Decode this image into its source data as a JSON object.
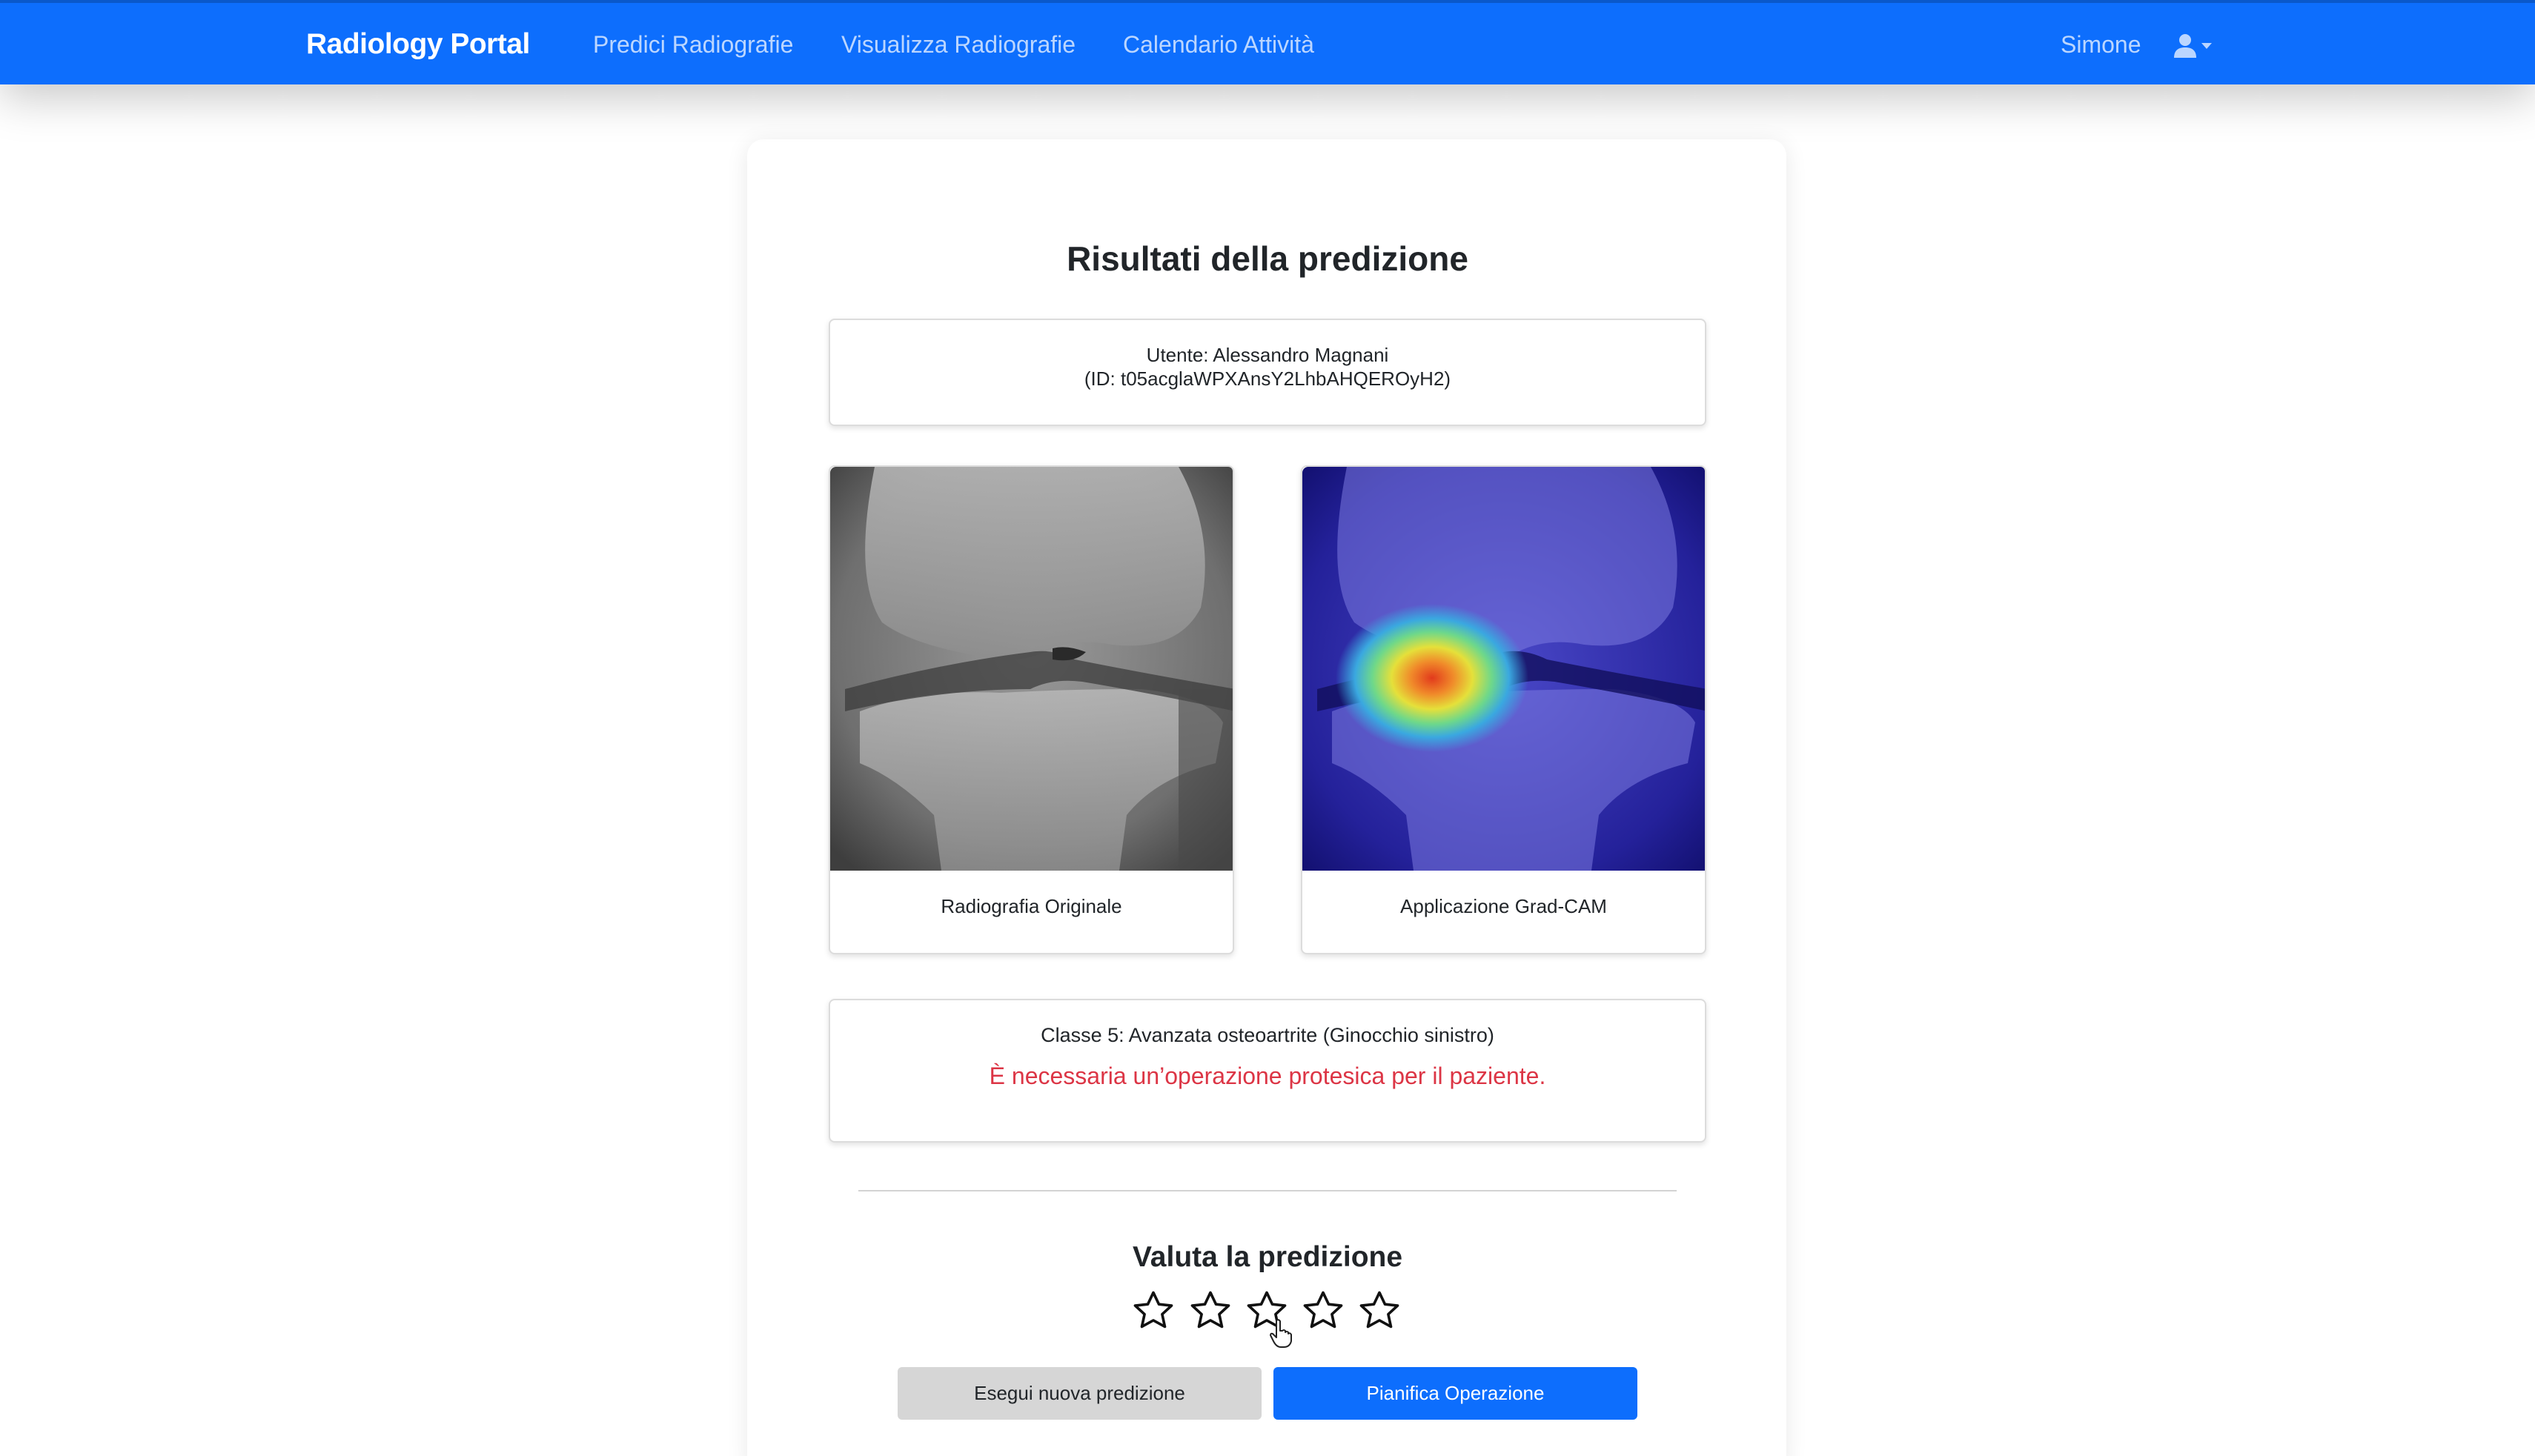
{
  "navbar": {
    "brand": "Radiology Portal",
    "links": [
      "Predici Radiografie",
      "Visualizza Radiografie",
      "Calendario Attività"
    ],
    "user_name": "Simone",
    "user_icon": "user-icon",
    "dropdown_icon": "caret-down-icon",
    "bg_color": "#0d6efd"
  },
  "page": {
    "title": "Risultati della predizione"
  },
  "user_info": {
    "line1": "Utente: Alessandro Magnani",
    "line2": "(ID: t05acglaWPXAnsY2LhbAHQEROyH2)"
  },
  "images": [
    {
      "caption": "Radiografia Originale",
      "kind": "x-ray-knee"
    },
    {
      "caption": "Applicazione Grad-CAM",
      "kind": "grad-cam-heatmap"
    }
  ],
  "result": {
    "class_label": "Classe 5: Avanzata osteoartrite (Ginocchio sinistro)",
    "warning": "È necessaria un’operazione protesica per il paziente.",
    "warning_color": "#dc3545"
  },
  "rating": {
    "title": "Valuta la predizione",
    "max_stars": 5,
    "selected": 0,
    "star_icon": "star-outline-icon"
  },
  "actions": {
    "new_prediction": "Esegui nuova predizione",
    "plan_operation": "Pianifica Operazione",
    "primary_color": "#0d6efd"
  }
}
